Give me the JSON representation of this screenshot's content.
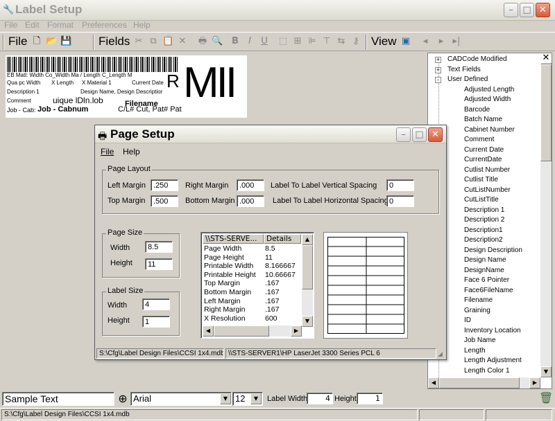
{
  "app": {
    "title": "Label Setup",
    "menu": [
      "File",
      "Edit",
      "Format",
      "Preferences",
      "Help"
    ],
    "toolbar": {
      "file_label": "File",
      "fields_label": "Fields",
      "view_label": "View"
    }
  },
  "label_preview": {
    "lines": [
      {
        "a": "EB Matl: Width Co_Width Ma / Length C_Length M"
      },
      {
        "a": "Qua pc Width",
        "b": "X Length",
        "c": "X Material 1",
        "d": "Current Date"
      },
      {
        "a": "Description 1",
        "b": "Design Name, Design Descriptior"
      },
      {
        "a": "Comment",
        "b": "uique lDln.lob",
        "c": "Filename"
      },
      {
        "a": "Job - Cab:",
        "b": "Job - Cabnum",
        "c": "C/L# Cut, Pat# Pat"
      }
    ],
    "big_r": "R",
    "big_text": "MII"
  },
  "tree": {
    "groups": [
      {
        "label": "CADCode Modified",
        "state": "+"
      },
      {
        "label": "Text Fields",
        "state": "+"
      },
      {
        "label": "User Defined",
        "state": "-"
      }
    ],
    "items": [
      "Adjusted Length",
      "Adjusted Width",
      "Barcode",
      "Batch Name",
      "Cabinet Number",
      "Comment",
      "Current Date",
      "CurrentDate",
      "Cutlist Number",
      "Cutlist Title",
      "CutListNumber",
      "CutListTitle",
      "Description 1",
      "Description 2",
      "Description1",
      "Description2",
      "Design Description",
      "Design Name",
      "DesignName",
      "Face 6 Pointer",
      "Face6FileName",
      "Filename",
      "Graining",
      "ID",
      "Inventory Location",
      "Job Name",
      "Length",
      "Length Adjustment",
      "Length Color 1"
    ]
  },
  "bottom": {
    "sample_text": "Sample Text",
    "font": "Arial",
    "size": "12",
    "label_width_label": "Label Width:",
    "label_width": "4",
    "height_label": "Height:",
    "height": "1"
  },
  "status": {
    "path": "S:\\Cfg\\Label Design Files\\CCSI 1x4.mdb"
  },
  "dialog": {
    "title": "Page Setup",
    "menu": [
      "File",
      "Help"
    ],
    "page_layout": {
      "label": "Page Layout",
      "left_margin_label": "Left Margin",
      "left_margin": ".250",
      "right_margin_label": "Right Margin",
      "right_margin": ".000",
      "vspacing_label": "Label To Label Vertical Spacing",
      "vspacing": "0",
      "top_margin_label": "Top Margin",
      "top_margin": ".500",
      "bottom_margin_label": "Bottom Margin",
      "bottom_margin": ".000",
      "hspacing_label": "Label To Label Horizontal Spacing",
      "hspacing": "0"
    },
    "page_size": {
      "label": "Page Size",
      "width_label": "Width",
      "width": "8.5",
      "height_label": "Height",
      "height": "11"
    },
    "label_size": {
      "label": "Label Size",
      "width_label": "Width",
      "width": "4",
      "height_label": "Height",
      "height": "1"
    },
    "printer_list": {
      "col1": "\\\\STS-SERVE...",
      "col2": "Details",
      "rows": [
        [
          "Page Width",
          "8.5"
        ],
        [
          "Page Height",
          "11"
        ],
        [
          "Printable Width",
          "8.166667"
        ],
        [
          "Printable Height",
          "10.66667"
        ],
        [
          "Top Margin",
          ".167"
        ],
        [
          "Bottom Margin",
          ".167"
        ],
        [
          "Left Margin",
          ".167"
        ],
        [
          "Right Margin",
          ".167"
        ],
        [
          "X Resolution",
          "600"
        ]
      ]
    },
    "status_left": "S:\\Cfg\\Label Design Files\\CCSI 1x4.mdb",
    "status_right": "\\\\STS-SERVER1\\HP LaserJet 3300 Series PCL 6"
  }
}
